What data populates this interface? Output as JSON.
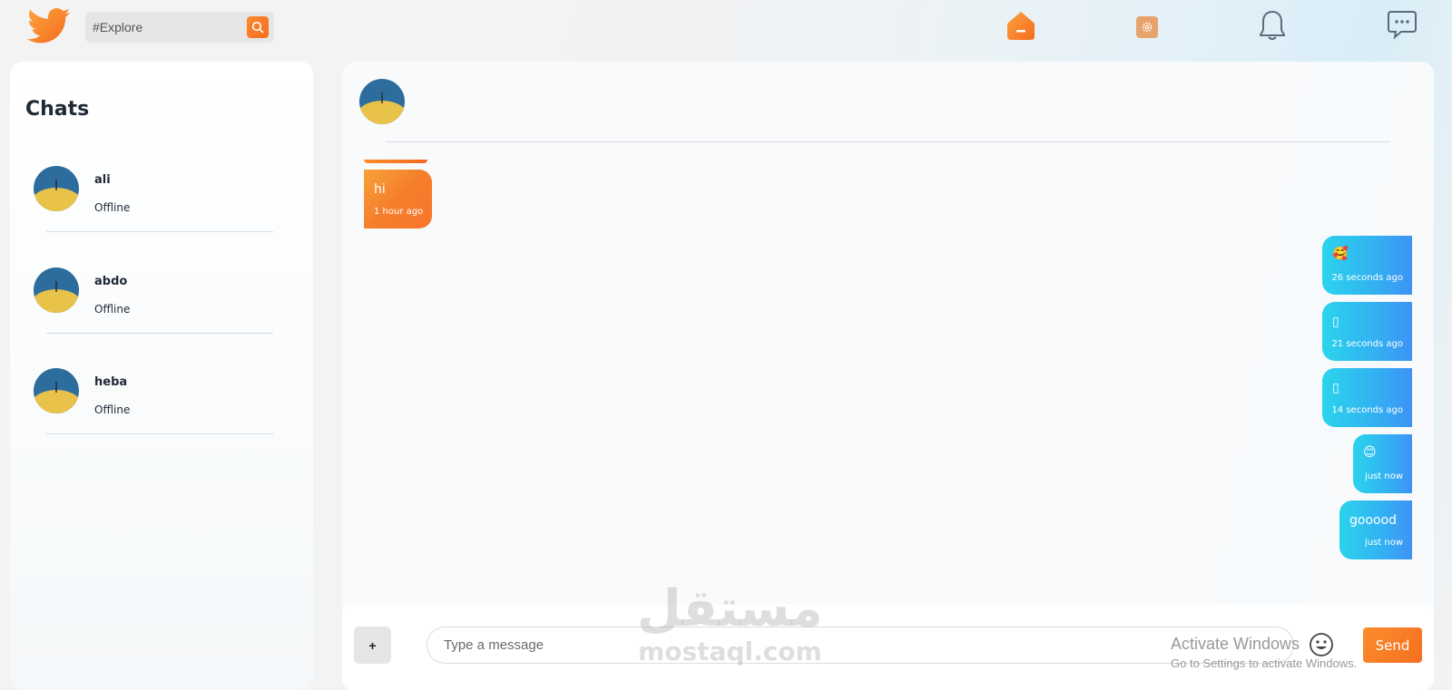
{
  "search": {
    "placeholder": "#Explore"
  },
  "sidebar": {
    "title": "Chats",
    "items": [
      {
        "name": "ali",
        "status": "Offline"
      },
      {
        "name": "abdo",
        "status": "Offline"
      },
      {
        "name": "heba",
        "status": "Offline"
      }
    ]
  },
  "messages": [
    {
      "direction": "incoming",
      "text": "hi",
      "time": "1 hour ago"
    },
    {
      "direction": "outgoing",
      "text": "🥰",
      "time": "26 seconds ago"
    },
    {
      "direction": "outgoing",
      "text": "▯",
      "time": "21 seconds ago"
    },
    {
      "direction": "outgoing",
      "text": "▯",
      "time": "14 seconds ago"
    },
    {
      "direction": "outgoing",
      "text": "😊",
      "time": "just now"
    },
    {
      "direction": "outgoing",
      "text": "gooood",
      "time": "just now"
    }
  ],
  "composer": {
    "attach_label": "+",
    "placeholder": "Type a message",
    "send_label": "Send"
  },
  "watermark": {
    "arabic": "مستقل",
    "latin": "mostaql.com"
  },
  "windows_notice": {
    "line1": "Activate Windows",
    "line2": "Go to Settings to activate Windows."
  },
  "colors": {
    "accent": "#f57e2c",
    "outgoing": "#33b0f2",
    "text": "#1f2937"
  },
  "icons": [
    "twitter-bird-icon",
    "search-icon",
    "home-icon",
    "settings-icon",
    "bell-icon",
    "chat-bubble-icon",
    "emoji-icon"
  ]
}
